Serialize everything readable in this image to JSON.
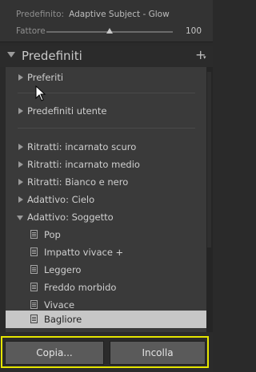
{
  "header": {
    "preset_label": "Predefinito:",
    "preset_value": "Adaptive Subject - Glow",
    "amount_label": "Fattore",
    "amount_value": "100",
    "amount_level": 0.5
  },
  "panel": {
    "title": "Predefiniti",
    "add_label": "+",
    "groups": [
      {
        "label": "Preferiti"
      },
      {
        "label": "Predefiniti utente"
      },
      {
        "label": "Ritratti: incarnato scuro"
      },
      {
        "label": "Ritratti: incarnato medio"
      },
      {
        "label": "Ritratti: Bianco e nero"
      },
      {
        "label": "Adattivo: Cielo"
      },
      {
        "label": "Adattivo: Soggetto"
      }
    ],
    "presets": [
      {
        "label": "Pop"
      },
      {
        "label": "Impatto vivace +"
      },
      {
        "label": "Leggero"
      },
      {
        "label": "Freddo morbido"
      },
      {
        "label": "Vivace"
      },
      {
        "label": "Bagliore"
      }
    ]
  },
  "buttons": {
    "copy_label": "Copia...",
    "paste_label": "Incolla"
  },
  "colors": {
    "highlight": "#e6e600",
    "selected_row": "#c7c7c7"
  }
}
